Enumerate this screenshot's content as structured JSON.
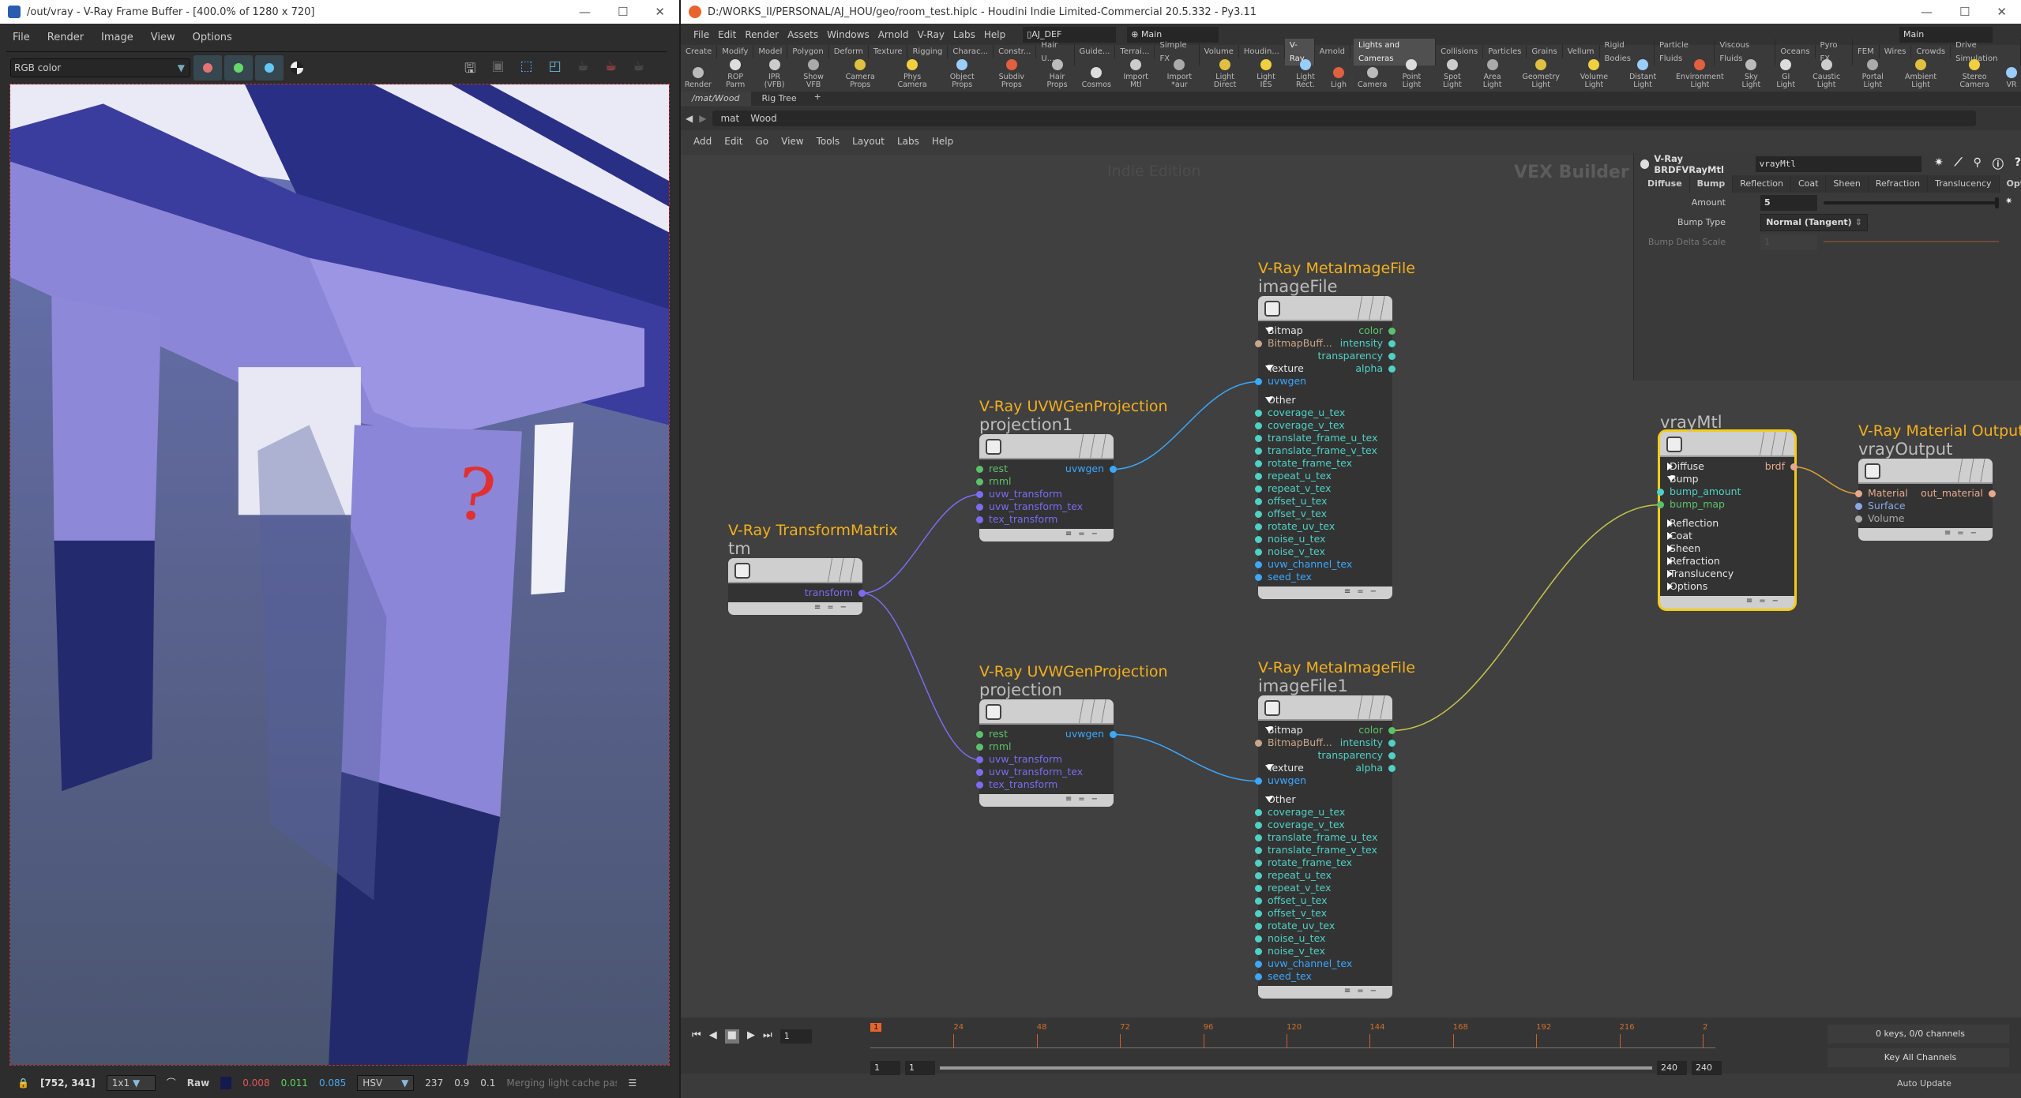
{
  "vfb": {
    "title": "/out/vray - V-Ray Frame Buffer - [400.0% of 1280 x 720]",
    "menu": [
      "File",
      "Render",
      "Image",
      "View",
      "Options"
    ],
    "channel": "RGB color",
    "channel_buttons": [
      {
        "name": "red-channel",
        "color": "#e57373"
      },
      {
        "name": "green-channel",
        "color": "#66d96b"
      },
      {
        "name": "blue-channel",
        "color": "#64c8f5"
      }
    ],
    "annotation": "?",
    "status": {
      "coords": "[752, 341]",
      "zoom": "1x1",
      "mode": "Raw",
      "swatch": "#141a4e",
      "r": "0.008",
      "g": "0.011",
      "b": "0.085",
      "space": "HSV",
      "h": "237",
      "s": "0.9",
      "v": "0.1",
      "message": "Merging light cache pass"
    }
  },
  "houdini": {
    "title": "D:/WORKS_II/PERSONAL/AJ_HOU/geo/room_test.hiplc - Houdini Indie Limited-Commercial 20.5.332 - Py3.11",
    "menu": [
      "File",
      "Edit",
      "Render",
      "Assets",
      "Windows",
      "Arnold",
      "V-Ray",
      "Labs",
      "Help"
    ],
    "desktop": "AJ_DEF",
    "context": "Main",
    "right_context": "Main",
    "shelf_tabs_left": [
      "Create",
      "Modify",
      "Model",
      "Polygon",
      "Deform",
      "Texture",
      "Rigging",
      "Charac...",
      "Constr...",
      "Hair U...",
      "Guide...",
      "Terrai...",
      "Simple FX",
      "Volume",
      "Houdin...",
      "V-Ray",
      "Arnold"
    ],
    "shelf_active_left": "V-Ray",
    "shelf_tools_left": [
      "Render",
      "ROP Parm",
      "IPR (VFB)",
      "Show VFB",
      "Camera Props",
      "Phys Camera",
      "Object Props",
      "Subdiv Props",
      "Hair Props",
      "Cosmos",
      "Import Mtl",
      "Import *aur",
      "Light Direct",
      "Light IES",
      "Light Rect.",
      "Ligh"
    ],
    "shelf_tabs_right": [
      "Lights and Cameras",
      "Collisions",
      "Particles",
      "Grains",
      "Vellum",
      "Rigid Bodies",
      "Particle Fluids",
      "Viscous Fluids",
      "Oceans",
      "Pyro FX",
      "FEM",
      "Wires",
      "Crowds",
      "Drive Simulation"
    ],
    "shelf_active_right": "Lights and Cameras",
    "shelf_tools_right": [
      "Camera",
      "Point Light",
      "Spot Light",
      "Area Light",
      "Geometry Light",
      "Volume Light",
      "Distant Light",
      "Environment Light",
      "Sky Light",
      "GI Light",
      "Caustic Light",
      "Portal Light",
      "Ambient Light",
      "Stereo Camera",
      "VR"
    ],
    "pane_tabs": [
      "/mat/Wood",
      "Rig Tree"
    ],
    "path": [
      "mat",
      "Wood"
    ],
    "net_menu": [
      "Add",
      "Edit",
      "Go",
      "View",
      "Tools",
      "Layout",
      "Labs",
      "Help"
    ],
    "watermark": "Indie Edition",
    "context_label": "VEX Builder"
  },
  "params": {
    "type": "V-Ray BRDFVRayMtl",
    "name": "vrayMtl",
    "tabs": [
      "Diffuse",
      "Bump",
      "Reflection",
      "Coat",
      "Sheen",
      "Refraction",
      "Translucency",
      "Options"
    ],
    "amount_label": "Amount",
    "amount": "5",
    "amount_fraction": 1.0,
    "bump_type_label": "Bump Type",
    "bump_type": "Normal (Tangent)",
    "delta_label": "Bump Delta Scale",
    "delta": "1"
  },
  "colors": {
    "float": "#4fd1c5",
    "color": "#5cc26a",
    "vector": "#3aa8ff",
    "matrix": "#7b6cf0",
    "bitmap": "#c9a78a",
    "brdf": "#e7a98c",
    "surface": "#8aa8e8",
    "volume": "#aaaaaa",
    "wire_uv": "#3aa8ff",
    "wire_tm": "#7b6cf0",
    "wire_col": "#c7c34a",
    "wire_brdf": "#d9a23a"
  },
  "nodes": [
    {
      "id": "tm",
      "type": "V-Ray TransformMatrix",
      "name": "tm",
      "rows": [
        {
          "r": "transform",
          "rc": "matrix"
        }
      ]
    },
    {
      "id": "projection1",
      "type": "V-Ray UVWGenProjection",
      "name": "projection1",
      "rows": [
        {
          "l": "rest",
          "lc": "color",
          "r": "uvwgen",
          "rc": "vector"
        },
        {
          "l": "rnml",
          "lc": "color"
        },
        {
          "l": "uvw_transform",
          "lc": "matrix"
        },
        {
          "l": "uvw_transform_tex",
          "lc": "matrix"
        },
        {
          "l": "tex_transform",
          "lc": "matrix"
        }
      ]
    },
    {
      "id": "projection",
      "type": "V-Ray UVWGenProjection",
      "name": "projection",
      "rows": [
        {
          "l": "rest",
          "lc": "color",
          "r": "uvwgen",
          "rc": "vector"
        },
        {
          "l": "rnml",
          "lc": "color"
        },
        {
          "l": "uvw_transform",
          "lc": "matrix"
        },
        {
          "l": "uvw_transform_tex",
          "lc": "matrix"
        },
        {
          "l": "tex_transform",
          "lc": "matrix"
        }
      ]
    },
    {
      "id": "imageFile",
      "type": "V-Ray MetaImageFile",
      "name": "imageFile",
      "rows": [
        {
          "g": "Bitmap",
          "r": "color",
          "rc": "color"
        },
        {
          "l": "BitmapBuff...",
          "lc": "bitmap",
          "r": "intensity",
          "rc": "float"
        },
        {
          "r": "transparency",
          "rc": "float"
        },
        {
          "g": "Texture",
          "r": "alpha",
          "rc": "float"
        },
        {
          "l": "uvwgen",
          "lc": "vector"
        },
        {
          "sp": 1
        },
        {
          "g": "Other"
        },
        {
          "l": "coverage_u_tex",
          "lc": "float"
        },
        {
          "l": "coverage_v_tex",
          "lc": "float"
        },
        {
          "l": "translate_frame_u_tex",
          "lc": "float"
        },
        {
          "l": "translate_frame_v_tex",
          "lc": "float"
        },
        {
          "l": "rotate_frame_tex",
          "lc": "float"
        },
        {
          "l": "repeat_u_tex",
          "lc": "float"
        },
        {
          "l": "repeat_v_tex",
          "lc": "float"
        },
        {
          "l": "offset_u_tex",
          "lc": "float"
        },
        {
          "l": "offset_v_tex",
          "lc": "float"
        },
        {
          "l": "rotate_uv_tex",
          "lc": "float"
        },
        {
          "l": "noise_u_tex",
          "lc": "float"
        },
        {
          "l": "noise_v_tex",
          "lc": "float"
        },
        {
          "l": "uvw_channel_tex",
          "lc": "vector"
        },
        {
          "l": "seed_tex",
          "lc": "vector"
        }
      ]
    },
    {
      "id": "imageFile1",
      "type": "V-Ray MetaImageFile",
      "name": "imageFile1",
      "rows": [
        {
          "g": "Bitmap",
          "r": "color",
          "rc": "color"
        },
        {
          "l": "BitmapBuff...",
          "lc": "bitmap",
          "r": "intensity",
          "rc": "float"
        },
        {
          "r": "transparency",
          "rc": "float"
        },
        {
          "g": "Texture",
          "r": "alpha",
          "rc": "float"
        },
        {
          "l": "uvwgen",
          "lc": "vector"
        },
        {
          "sp": 1
        },
        {
          "g": "Other"
        },
        {
          "l": "coverage_u_tex",
          "lc": "float"
        },
        {
          "l": "coverage_v_tex",
          "lc": "float"
        },
        {
          "l": "translate_frame_u_tex",
          "lc": "float"
        },
        {
          "l": "translate_frame_v_tex",
          "lc": "float"
        },
        {
          "l": "rotate_frame_tex",
          "lc": "float"
        },
        {
          "l": "repeat_u_tex",
          "lc": "float"
        },
        {
          "l": "repeat_v_tex",
          "lc": "float"
        },
        {
          "l": "offset_u_tex",
          "lc": "float"
        },
        {
          "l": "offset_v_tex",
          "lc": "float"
        },
        {
          "l": "rotate_uv_tex",
          "lc": "float"
        },
        {
          "l": "noise_u_tex",
          "lc": "float"
        },
        {
          "l": "noise_v_tex",
          "lc": "float"
        },
        {
          "l": "uvw_channel_tex",
          "lc": "vector"
        },
        {
          "l": "seed_tex",
          "lc": "vector"
        }
      ]
    },
    {
      "id": "vrayMtl",
      "type": "",
      "name": "vrayMtl",
      "selected": true,
      "rows": [
        {
          "gc": "Diffuse",
          "r": "brdf",
          "rc": "brdf"
        },
        {
          "g": "Bump"
        },
        {
          "l": "bump_amount",
          "lc": "float"
        },
        {
          "l": "bump_map",
          "lc": "color"
        },
        {
          "sp": 1
        },
        {
          "gc": "Reflection"
        },
        {
          "gc": "Coat"
        },
        {
          "gc": "Sheen"
        },
        {
          "gc": "Refraction"
        },
        {
          "gc": "Translucency"
        },
        {
          "gc": "Options"
        }
      ]
    },
    {
      "id": "vrayOutput",
      "type": "V-Ray Material Output",
      "name": "vrayOutput",
      "rows": [
        {
          "l": "Material",
          "lc": "brdf",
          "r": "out_material",
          "rc": "brdf"
        },
        {
          "l": "Surface",
          "lc": "surface"
        },
        {
          "l": "Volume",
          "lc": "volume"
        }
      ]
    }
  ],
  "wires": [
    {
      "from": "tm.transform",
      "to": "projection1.uvw_transform",
      "c": "wire_tm"
    },
    {
      "from": "tm.transform",
      "to": "projection.uvw_transform",
      "c": "wire_tm"
    },
    {
      "from": "projection1.uvwgen",
      "to": "imageFile.uvwgen",
      "c": "wire_uv"
    },
    {
      "from": "projection.uvwgen",
      "to": "imageFile1.uvwgen",
      "c": "wire_uv"
    },
    {
      "from": "imageFile1.color",
      "to": "vrayMtl.bump_map",
      "c": "wire_col"
    },
    {
      "from": "vrayMtl.brdf",
      "to": "vrayOutput.Material",
      "c": "wire_brdf"
    }
  ],
  "timeline": {
    "frame": "1",
    "ticks": [
      "24",
      "48",
      "72",
      "96",
      "120",
      "144",
      "168",
      "192",
      "216",
      "2"
    ],
    "start": "1",
    "start2": "1",
    "end": "240",
    "end2": "240",
    "keys": "0 keys, 0/0 channels",
    "key_all": "Key All Channels",
    "update": "Auto Update"
  }
}
